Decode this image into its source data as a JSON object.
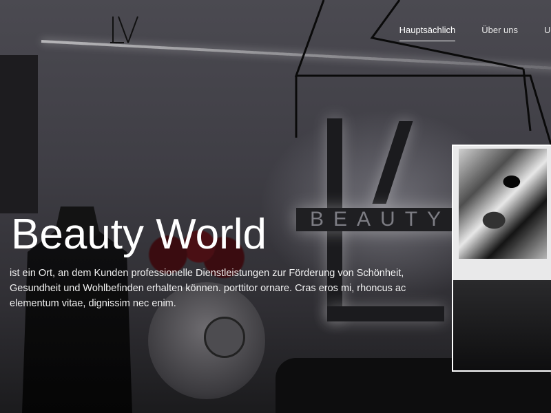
{
  "brand": {
    "logo_icon": "lv-monogram-icon"
  },
  "nav": {
    "items": [
      {
        "label": "Hauptsächlich",
        "active": true
      },
      {
        "label": "Über uns",
        "active": false
      },
      {
        "label": "U",
        "active": false
      }
    ]
  },
  "hero": {
    "title": "Beauty World",
    "description": "ist ein Ort, an dem Kunden professionelle Dienstleistungen zur Förderung von Schönheit, Gesundheit und Wohlbefinden erhalten können. porttitor ornare. Cras eros mi, rhoncus ac elementum vitae, dignissim nec enim.",
    "sign_text": "BEAUTY W"
  },
  "colors": {
    "background": "#2a292c",
    "text": "#ffffff",
    "card_border": "#ffffff"
  }
}
